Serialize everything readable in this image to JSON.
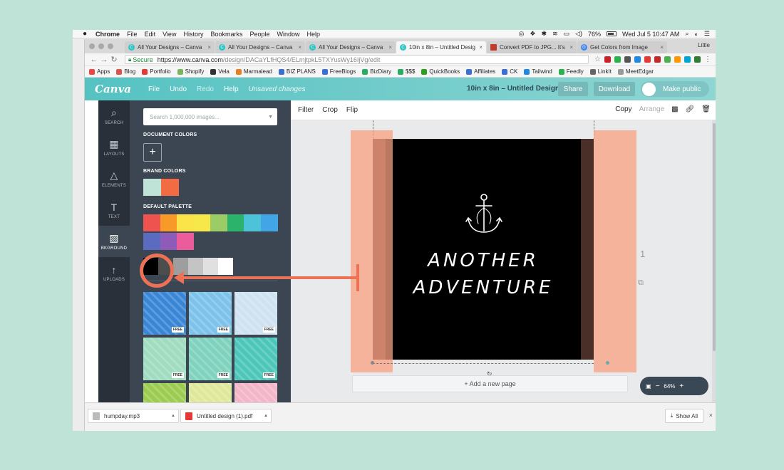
{
  "mac_menubar": {
    "app": "Chrome",
    "menus": [
      "File",
      "Edit",
      "View",
      "History",
      "Bookmarks",
      "People",
      "Window",
      "Help"
    ],
    "battery": "76%",
    "datetime": "Wed Jul 5  10:47 AM"
  },
  "browser": {
    "tabs": [
      {
        "title": "All Your Designs – Canva",
        "color": "#2ec4c4",
        "active": false
      },
      {
        "title": "All Your Designs – Canva",
        "color": "#2ec4c4",
        "active": false
      },
      {
        "title": "All Your Designs – Canva",
        "color": "#2ec4c4",
        "active": false
      },
      {
        "title": "10in x 8in – Untitled Desig",
        "color": "#2ec4c4",
        "active": true
      },
      {
        "title": "Convert PDF to JPG... It's",
        "color": "#c0392b",
        "active": false
      },
      {
        "title": "Get Colors from Image",
        "color": "#4285f4",
        "active": false
      }
    ],
    "profile": "Little",
    "secure_label": "Secure",
    "url_host": "https://www.canva.com",
    "url_path": "/design/DACaYLfHQS4/ELmjtpkL5TXYusWy16IjVg/edit",
    "bookmarks": [
      {
        "label": "Apps",
        "color": "#e44"
      },
      {
        "label": "Blog",
        "color": "#d9534f"
      },
      {
        "label": "Portfolio",
        "color": "#e53935"
      },
      {
        "label": "Shopify",
        "color": "#7ab55c"
      },
      {
        "label": "Vela",
        "color": "#333"
      },
      {
        "label": "Marmalead",
        "color": "#e67e22"
      },
      {
        "label": "BIZ PLANS",
        "color": "#3b6fd6"
      },
      {
        "label": "FreeBlogs",
        "color": "#3b6fd6"
      },
      {
        "label": "BizDiary",
        "color": "#27ae60"
      },
      {
        "label": "$$$",
        "color": "#27ae60"
      },
      {
        "label": "QuickBooks",
        "color": "#2ca01c"
      },
      {
        "label": "Affiliates",
        "color": "#3b6fd6"
      },
      {
        "label": "CK",
        "color": "#3b6fd6"
      },
      {
        "label": "Tailwind",
        "color": "#1e88e5"
      },
      {
        "label": "Feedly",
        "color": "#2bb24c"
      },
      {
        "label": "LinkIt",
        "color": "#666"
      },
      {
        "label": "MeetEdgar",
        "color": "#999"
      }
    ]
  },
  "canva": {
    "logo": "Canva",
    "menu": {
      "file": "File",
      "undo": "Undo",
      "redo": "Redo",
      "help": "Help",
      "unsaved": "Unsaved changes"
    },
    "design_title": "10in x 8in – Untitled Design",
    "share": "Share",
    "download": "Download",
    "make_public": "Make public",
    "rail": [
      {
        "icon": "⌕",
        "label": "SEARCH"
      },
      {
        "icon": "▦",
        "label": "LAYOUTS"
      },
      {
        "icon": "△",
        "label": "ELEMENTS"
      },
      {
        "icon": "T",
        "label": "TEXT"
      },
      {
        "icon": "▨",
        "label": "BKGROUND"
      },
      {
        "icon": "↑",
        "label": "UPLOADS"
      }
    ],
    "panel": {
      "search_placeholder": "Search 1,000,000 images...",
      "document_colors": "DOCUMENT COLORS",
      "brand_colors": "BRAND COLORS",
      "default_palette": "DEFAULT PALETTE",
      "brand_swatches": [
        "#bfe3d6",
        "#f26b43"
      ],
      "palette_row1": [
        "#ef5350",
        "#f79a27",
        "#fbe34a",
        "#f6e84a",
        "#9ccc65",
        "#2cb36b",
        "#4cc3d9",
        "#42a5e6"
      ],
      "palette_row2": [
        "#5b6bbf",
        "#8e5cb8",
        "#ec5b9b"
      ],
      "palette_row3": [
        "#000000",
        "#4d4d4d",
        "#9e9e9e",
        "#c4c4c4",
        "#e0e0e0",
        "#ffffff"
      ],
      "free_label": "FREE",
      "tiles": [
        {
          "color": "#3a86d6"
        },
        {
          "color": "#7cc2ea"
        },
        {
          "color": "#cfe2f2"
        },
        {
          "color": "#9fdcc0"
        },
        {
          "color": "#7fd2bd"
        },
        {
          "color": "#4cc6b8"
        },
        {
          "color": "#9ccc4f"
        },
        {
          "color": "#dfe89a"
        },
        {
          "color": "#f3b6c8"
        }
      ]
    },
    "toolbar": {
      "filter": "Filter",
      "crop": "Crop",
      "flip": "Flip",
      "copy": "Copy",
      "arrange": "Arrange"
    },
    "design": {
      "line1": "ANOTHER",
      "line2": "ADVENTURE"
    },
    "add_page": "+ Add a new page",
    "page_number": "1",
    "zoom": "64%"
  },
  "downloads": [
    {
      "name": "humpday.mp3",
      "color": "#bbb"
    },
    {
      "name": "Untitled design (1).pdf",
      "color": "#e53935"
    }
  ],
  "show_all": "Show All"
}
